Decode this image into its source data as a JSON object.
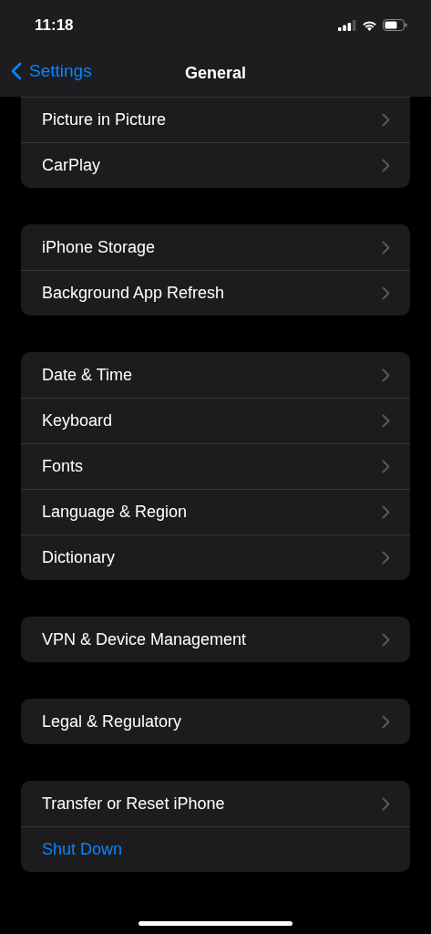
{
  "status_bar": {
    "time": "11:18"
  },
  "nav": {
    "back": "Settings",
    "title": "General"
  },
  "groups": [
    {
      "cut_top": true,
      "rows": [
        {
          "label": "Picture in Picture",
          "kind": "link"
        },
        {
          "label": "CarPlay",
          "kind": "link"
        }
      ]
    },
    {
      "cut_top": false,
      "rows": [
        {
          "label": "iPhone Storage",
          "kind": "link"
        },
        {
          "label": "Background App Refresh",
          "kind": "link"
        }
      ]
    },
    {
      "cut_top": false,
      "rows": [
        {
          "label": "Date & Time",
          "kind": "link"
        },
        {
          "label": "Keyboard",
          "kind": "link"
        },
        {
          "label": "Fonts",
          "kind": "link"
        },
        {
          "label": "Language & Region",
          "kind": "link"
        },
        {
          "label": "Dictionary",
          "kind": "link"
        }
      ]
    },
    {
      "cut_top": false,
      "rows": [
        {
          "label": "VPN & Device Management",
          "kind": "link"
        }
      ]
    },
    {
      "cut_top": false,
      "rows": [
        {
          "label": "Legal & Regulatory",
          "kind": "link"
        }
      ]
    },
    {
      "cut_top": false,
      "rows": [
        {
          "label": "Transfer or Reset iPhone",
          "kind": "link"
        },
        {
          "label": "Shut Down",
          "kind": "action"
        }
      ]
    }
  ]
}
